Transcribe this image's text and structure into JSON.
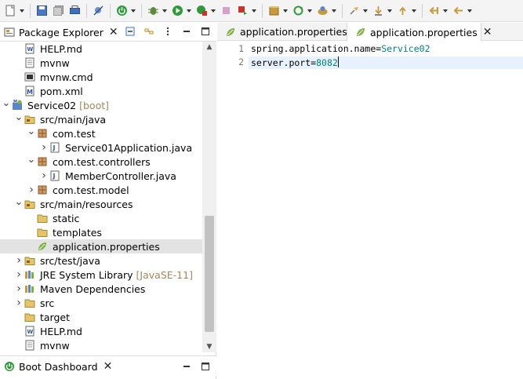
{
  "toolbar": {
    "icons": [
      "new-icon",
      "save-icon",
      "save-all-icon",
      "print-icon",
      "skip-breakpoints-icon",
      "spring-boot-icon",
      "debug-icon",
      "run-icon",
      "run-stop-icon",
      "stop-icon",
      "run-config-icon",
      "new-spring-starter-icon",
      "refresh-icon",
      "open-type-icon",
      "pin-icon",
      "next-annotation-icon",
      "prev-annotation-icon",
      "last-edit-icon",
      "back-icon"
    ]
  },
  "package_explorer": {
    "title": "Package Explorer",
    "items": [
      {
        "label": "HELP.md",
        "icon": "markdown-file-icon",
        "indent": 0,
        "twisty": "",
        "decoration": ""
      },
      {
        "label": "mvnw",
        "icon": "text-file-icon",
        "indent": 0,
        "twisty": "",
        "decoration": ""
      },
      {
        "label": "mvnw.cmd",
        "icon": "cmd-file-icon",
        "indent": 0,
        "twisty": "",
        "decoration": ""
      },
      {
        "label": "pom.xml",
        "icon": "maven-pom-icon",
        "indent": 0,
        "twisty": "",
        "decoration": ""
      },
      {
        "label": "Service02",
        "icon": "spring-project-icon",
        "indent": -1,
        "twisty": "open",
        "decoration": "[boot]"
      },
      {
        "label": "src/main/java",
        "icon": "source-folder-icon",
        "indent": 0,
        "twisty": "open",
        "decoration": ""
      },
      {
        "label": "com.test",
        "icon": "package-icon",
        "indent": 1,
        "twisty": "open",
        "decoration": ""
      },
      {
        "label": "Service01Application.java",
        "icon": "java-file-icon",
        "indent": 2,
        "twisty": "closed",
        "decoration": ""
      },
      {
        "label": "com.test.controllers",
        "icon": "package-icon",
        "indent": 1,
        "twisty": "open",
        "decoration": ""
      },
      {
        "label": "MemberController.java",
        "icon": "java-file-icon",
        "indent": 2,
        "twisty": "closed",
        "decoration": ""
      },
      {
        "label": "com.test.model",
        "icon": "package-icon",
        "indent": 1,
        "twisty": "closed",
        "decoration": ""
      },
      {
        "label": "src/main/resources",
        "icon": "source-folder-icon",
        "indent": 0,
        "twisty": "open",
        "decoration": ""
      },
      {
        "label": "static",
        "icon": "folder-icon",
        "indent": 1,
        "twisty": "",
        "decoration": ""
      },
      {
        "label": "templates",
        "icon": "folder-icon",
        "indent": 1,
        "twisty": "",
        "decoration": ""
      },
      {
        "label": "application.properties",
        "icon": "properties-file-icon",
        "indent": 1,
        "twisty": "",
        "decoration": "",
        "selected": true
      },
      {
        "label": "src/test/java",
        "icon": "source-folder-icon",
        "indent": 0,
        "twisty": "closed",
        "decoration": ""
      },
      {
        "label": "JRE System Library",
        "icon": "library-icon",
        "indent": 0,
        "twisty": "closed",
        "decoration": "[JavaSE-11]"
      },
      {
        "label": "Maven Dependencies",
        "icon": "library-icon",
        "indent": 0,
        "twisty": "closed",
        "decoration": ""
      },
      {
        "label": "src",
        "icon": "folder-icon",
        "indent": 0,
        "twisty": "closed",
        "decoration": ""
      },
      {
        "label": "target",
        "icon": "folder-icon",
        "indent": 0,
        "twisty": "",
        "decoration": ""
      },
      {
        "label": "HELP.md",
        "icon": "markdown-file-icon",
        "indent": 0,
        "twisty": "",
        "decoration": ""
      },
      {
        "label": "mvnw",
        "icon": "text-file-icon",
        "indent": 0,
        "twisty": "",
        "decoration": ""
      }
    ]
  },
  "boot_dashboard": {
    "title": "Boot Dashboard"
  },
  "editor": {
    "tabs": [
      {
        "label": "application.properties",
        "active": false
      },
      {
        "label": "application.properties",
        "active": true
      }
    ],
    "lines": [
      {
        "number": "1",
        "key": "spring.application.name",
        "sep": "=",
        "value": "Service02"
      },
      {
        "number": "2",
        "key": "server.port",
        "sep": "=",
        "value": "8082"
      }
    ]
  },
  "colors": {
    "decoration": "#a0885a",
    "value": "#008080",
    "current_line": "#e8f2fe",
    "selection": "#e3e3e3"
  }
}
